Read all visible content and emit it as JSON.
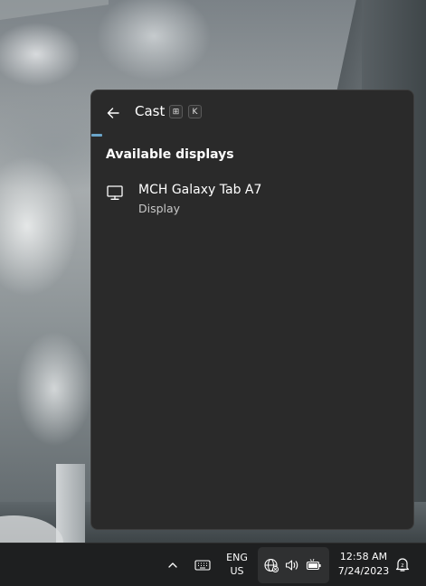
{
  "cast_panel": {
    "title": "Cast",
    "shortcut_keys": [
      "⊞",
      "K"
    ],
    "section_title": "Available displays",
    "devices": [
      {
        "name": "MCH Galaxy Tab A7",
        "type": "Display"
      }
    ]
  },
  "taskbar": {
    "language_primary": "ENG",
    "language_secondary": "US",
    "time": "12:58 AM",
    "date": "7/24/2023",
    "icons": [
      "chevron-up-icon",
      "touch-keyboard-icon",
      "network-globe-icon",
      "volume-icon",
      "battery-icon",
      "notification-bell-icon"
    ]
  },
  "colors": {
    "panel_bg": "#2a2a2a",
    "accent": "#6aa4c9",
    "taskbar_bg": "#1e1f20"
  }
}
